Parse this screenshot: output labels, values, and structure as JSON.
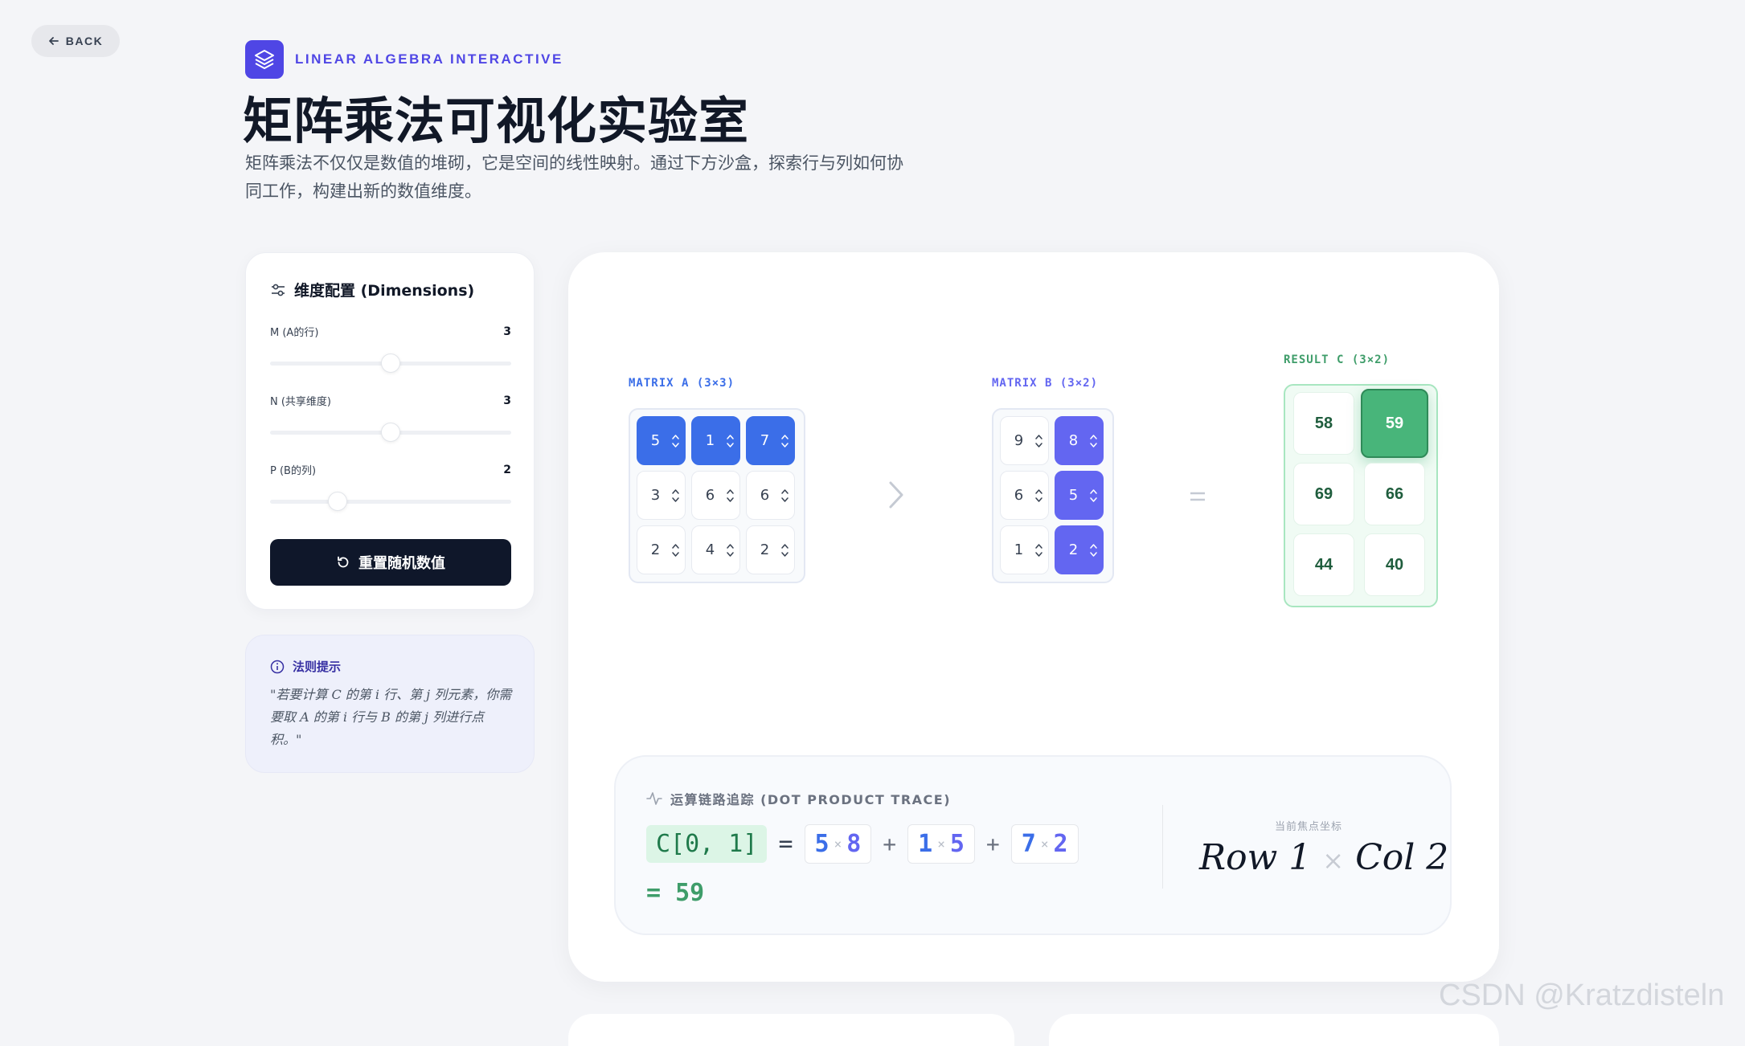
{
  "back_label": "BACK",
  "brand": "LINEAR ALGEBRA INTERACTIVE",
  "title": "矩阵乘法可视化实验室",
  "description": "矩阵乘法不仅仅是数值的堆砌，它是空间的线性映射。通过下方沙盒，探索行与列如何协同工作，构建出新的数值维度。",
  "dimensions": {
    "heading": "维度配置 (Dimensions)",
    "m_label": "M (A的行)",
    "m_value": "3",
    "m_fraction": 0.5,
    "n_label": "N (共享维度)",
    "n_value": "3",
    "n_fraction": 0.5,
    "p_label": "P (B的列)",
    "p_value": "2",
    "p_fraction": 0.28,
    "reset_label": "重置随机数值"
  },
  "hint": {
    "heading": "法则提示",
    "body": "\"若要计算 C 的第 i 行、第 j 列元素，你需要取 A 的第 i 行与 B 的第 j 列进行点积。\""
  },
  "matrix_a": {
    "label": "MATRIX A (3×3)",
    "rows": [
      [
        "5",
        "1",
        "7"
      ],
      [
        "3",
        "6",
        "6"
      ],
      [
        "2",
        "4",
        "2"
      ]
    ],
    "highlight_row": 0
  },
  "matrix_b": {
    "label": "MATRIX B (3×2)",
    "rows": [
      [
        "9",
        "8"
      ],
      [
        "6",
        "5"
      ],
      [
        "1",
        "2"
      ]
    ],
    "highlight_col": 1
  },
  "result": {
    "label": "RESULT C (3×2)",
    "rows": [
      [
        "58",
        "59"
      ],
      [
        "69",
        "66"
      ],
      [
        "44",
        "40"
      ]
    ],
    "active": [
      0,
      1
    ]
  },
  "trace": {
    "heading": "运算链路追踪 (DOT PRODUCT TRACE)",
    "coord": "C[0, 1]",
    "eq": "=",
    "plus": "+",
    "times": "×",
    "terms": [
      [
        "5",
        "8"
      ],
      [
        "1",
        "5"
      ],
      [
        "7",
        "2"
      ]
    ],
    "result": "= 59",
    "focus_label": "当前焦点坐标",
    "focus_row": "Row 1",
    "focus_col": "Col 2"
  },
  "watermark": "CSDN @Kratzdisteln",
  "colors": {
    "accent": "#4f46e5",
    "row_highlight": "#3b6ee8",
    "col_highlight": "#6366f1",
    "result_active": "#48b57a"
  }
}
